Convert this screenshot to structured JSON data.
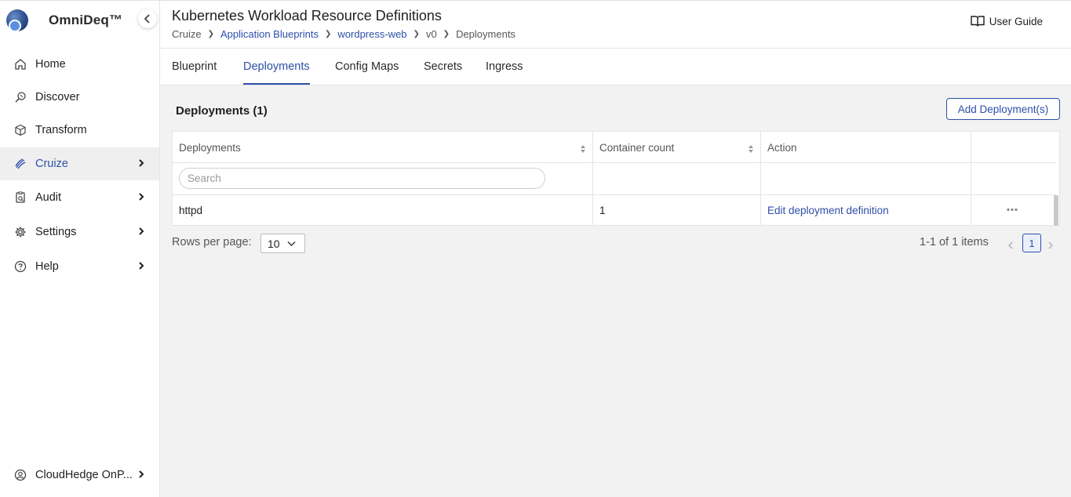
{
  "app": {
    "brand": "OmniDeq™"
  },
  "sidebar": {
    "items": [
      {
        "label": "Home",
        "icon": "home-icon"
      },
      {
        "label": "Discover",
        "icon": "discover-icon"
      },
      {
        "label": "Transform",
        "icon": "cube-icon"
      },
      {
        "label": "Cruize",
        "icon": "cruize-icon",
        "active": true
      },
      {
        "label": "Audit",
        "icon": "audit-icon"
      },
      {
        "label": "Settings",
        "icon": "gear-icon"
      },
      {
        "label": "Help",
        "icon": "help-icon"
      }
    ],
    "account": {
      "label": "CloudHedge OnP...",
      "icon": "user-icon"
    }
  },
  "header": {
    "title": "Kubernetes Workload Resource Definitions",
    "breadcrumb": [
      "Cruize",
      "Application Blueprints",
      "wordpress-web",
      "v0",
      "Deployments"
    ],
    "user_guide": "User Guide"
  },
  "tabs": [
    "Blueprint",
    "Deployments",
    "Config Maps",
    "Secrets",
    "Ingress"
  ],
  "active_tab": "Deployments",
  "section": {
    "title": "Deployments (1)",
    "add_button": "Add Deployment(s)"
  },
  "table": {
    "columns": [
      "Deployments",
      "Container count",
      "Action"
    ],
    "search_placeholder": "Search",
    "rows": [
      {
        "name": "httpd",
        "container_count": "1",
        "action": "Edit deployment definition"
      }
    ]
  },
  "pagination": {
    "rows_per_page_label": "Rows per page:",
    "rows_per_page": "10",
    "count": "1-1 of 1 items",
    "current_page": "1"
  },
  "colors": {
    "accent": "#2d4fa8",
    "background": "#f2f2f2"
  }
}
